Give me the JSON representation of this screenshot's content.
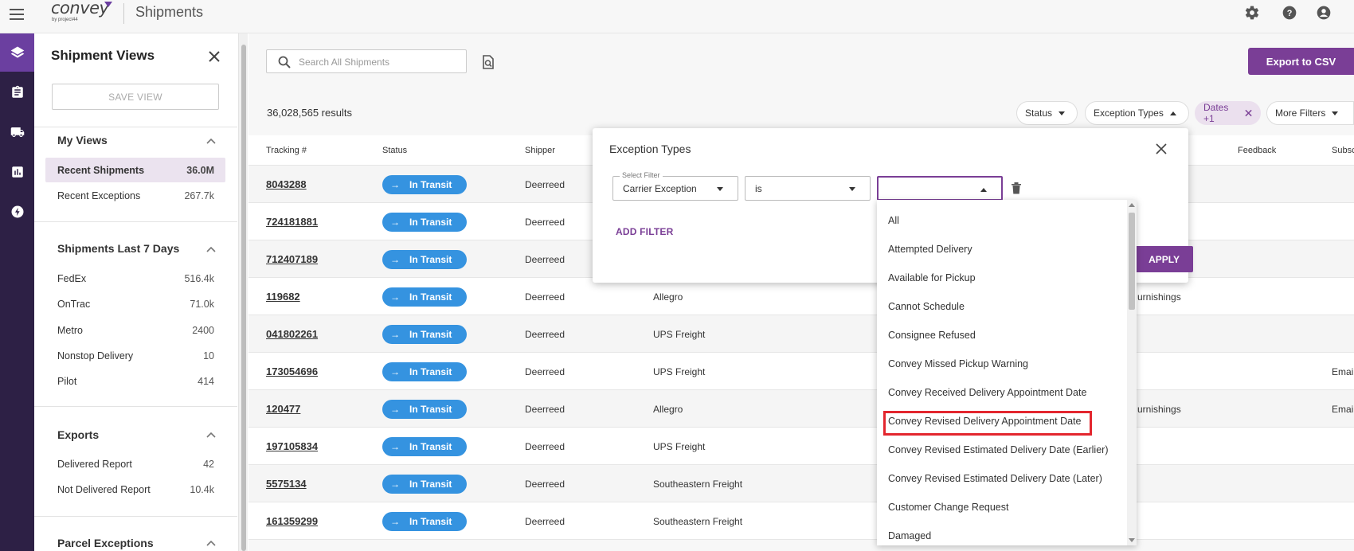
{
  "header": {
    "logo_text": "convey",
    "logo_subtext": "by project44",
    "title": "Shipments"
  },
  "side_panel": {
    "title": "Shipment Views",
    "save_view_label": "SAVE VIEW",
    "sections": [
      {
        "title": "My Views",
        "items": [
          {
            "label": "Recent Shipments",
            "count": "36.0M"
          },
          {
            "label": "Recent Exceptions",
            "count": "267.7k"
          }
        ]
      },
      {
        "title": "Shipments Last 7 Days",
        "items": [
          {
            "label": "FedEx",
            "count": "516.4k"
          },
          {
            "label": "OnTrac",
            "count": "71.0k"
          },
          {
            "label": "Metro",
            "count": "2400"
          },
          {
            "label": "Nonstop Delivery",
            "count": "10"
          },
          {
            "label": "Pilot",
            "count": "414"
          }
        ]
      },
      {
        "title": "Exports",
        "items": [
          {
            "label": "Delivered Report",
            "count": "42"
          },
          {
            "label": "Not Delivered Report",
            "count": "10.4k"
          }
        ]
      },
      {
        "title": "Parcel Exceptions",
        "items": []
      }
    ]
  },
  "toolbar": {
    "search_placeholder": "Search All Shipments",
    "export_label": "Export to CSV",
    "results_text": "36,028,565 results",
    "filters": [
      {
        "label": "Status"
      },
      {
        "label": "Exception Types"
      },
      {
        "label": "Dates +1"
      },
      {
        "label": "More Filters"
      }
    ]
  },
  "table": {
    "columns": [
      "Tracking #",
      "Status",
      "Shipper",
      "Feedback",
      "Subsc"
    ],
    "rows": [
      {
        "tracking": "8043288",
        "status": "In Transit",
        "shipper": "Deerreed",
        "carrier": "",
        "extra": "",
        "subsc": ""
      },
      {
        "tracking": "724181881",
        "status": "In Transit",
        "shipper": "Deerreed",
        "carrier": "",
        "extra": "",
        "subsc": ""
      },
      {
        "tracking": "712407189",
        "status": "In Transit",
        "shipper": "Deerreed",
        "carrier": "",
        "extra": "",
        "subsc": ""
      },
      {
        "tracking": "119682",
        "status": "In Transit",
        "shipper": "Deerreed",
        "carrier": "Allegro",
        "extra": "urnishings",
        "subsc": ""
      },
      {
        "tracking": "041802261",
        "status": "In Transit",
        "shipper": "Deerreed",
        "carrier": "UPS Freight",
        "extra": "",
        "subsc": ""
      },
      {
        "tracking": "173054696",
        "status": "In Transit",
        "shipper": "Deerreed",
        "carrier": "UPS Freight",
        "extra": "",
        "subsc": "Emai"
      },
      {
        "tracking": "120477",
        "status": "In Transit",
        "shipper": "Deerreed",
        "carrier": "Allegro",
        "extra": "urnishings",
        "subsc": "Emai"
      },
      {
        "tracking": "197105834",
        "status": "In Transit",
        "shipper": "Deerreed",
        "carrier": "UPS Freight",
        "extra": "",
        "subsc": ""
      },
      {
        "tracking": "5575134",
        "status": "In Transit",
        "shipper": "Deerreed",
        "carrier": "Southeastern Freight",
        "extra": "",
        "subsc": ""
      },
      {
        "tracking": "161359299",
        "status": "In Transit",
        "shipper": "Deerreed",
        "carrier": "Southeastern Freight",
        "extra": "",
        "subsc": ""
      }
    ]
  },
  "dialog": {
    "title": "Exception Types",
    "select_filter_label": "Select Filter",
    "select_filter_value": "Carrier Exception",
    "operator_value": "is",
    "value_value": "",
    "add_filter_label": "ADD FILTER",
    "apply_label": "APPLY",
    "options": [
      "All",
      "Attempted Delivery",
      "Available for Pickup",
      "Cannot Schedule",
      "Consignee Refused",
      "Convey Missed Pickup Warning",
      "Convey Received Delivery Appointment Date",
      "Convey Revised Delivery Appointment Date",
      "Convey Revised Estimated Delivery Date (Earlier)",
      "Convey Revised Estimated Delivery Date (Later)",
      "Customer Change Request",
      "Damaged"
    ],
    "highlighted_option": "Convey Revised Delivery Appointment Date"
  },
  "colors": {
    "brand_purple": "#7a3e96",
    "rail_dark": "#2d2045",
    "status_blue": "#3593e0",
    "highlight_red": "#e3262e"
  }
}
